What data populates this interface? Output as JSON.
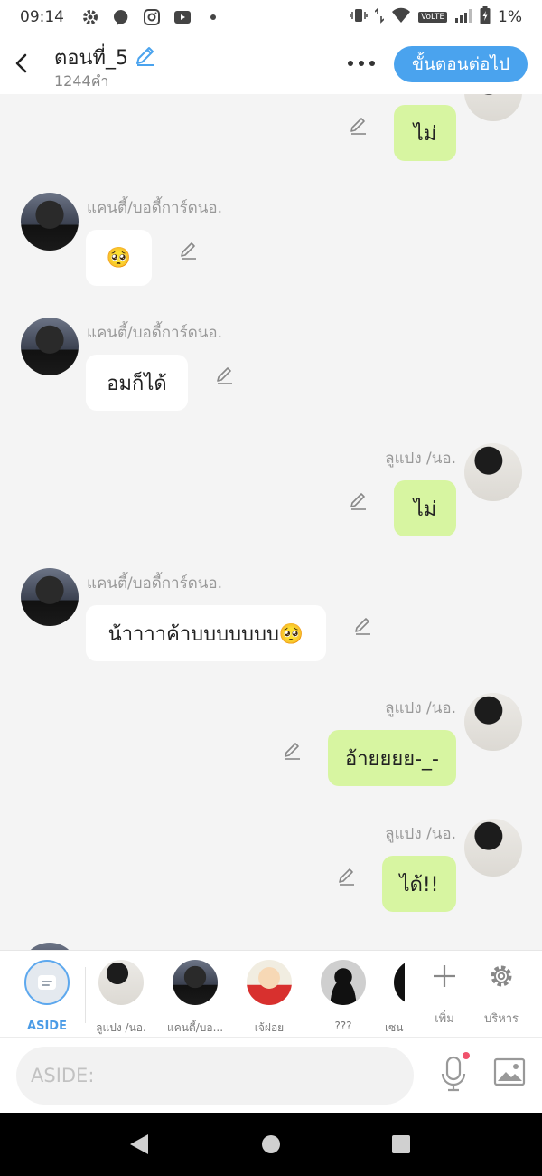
{
  "status_bar": {
    "time": "09:14",
    "network": "VoLTE",
    "battery": "1%"
  },
  "header": {
    "title": "ตอนที่_5",
    "word_count": "1244คำ",
    "next_button_label": "ขั้นตอนต่อไป"
  },
  "messages": [
    {
      "side": "out",
      "sender": "",
      "text": "ไม่"
    },
    {
      "side": "in",
      "sender": "แคนตี้/บอดี้การ์ดนอ.",
      "text": "🥺"
    },
    {
      "side": "in",
      "sender": "แคนตี้/บอดี้การ์ดนอ.",
      "text": "อมก็ได้"
    },
    {
      "side": "out",
      "sender": "ลูแปง /นอ.",
      "text": "ไม่"
    },
    {
      "side": "in",
      "sender": "แคนตี้/บอดี้การ์ดนอ.",
      "text": "น้าาาาค้าบบบบบบบ🥺"
    },
    {
      "side": "out",
      "sender": "ลูแปง /นอ.",
      "text": "อ้ายยยย-_-"
    },
    {
      "side": "out",
      "sender": "ลูแปง /นอ.",
      "text": "ได้!!"
    }
  ],
  "characters": [
    {
      "name": "ASIDE"
    },
    {
      "name": "ลูแปง /นอ."
    },
    {
      "name": "แคนตี้/บอ..."
    },
    {
      "name": "เจ้ฝอย"
    },
    {
      "name": "???"
    },
    {
      "name": "เซน"
    }
  ],
  "tools": {
    "add_label": "เพิ่ม",
    "manage_label": "บริหาร"
  },
  "input": {
    "placeholder": "ASIDE:"
  }
}
